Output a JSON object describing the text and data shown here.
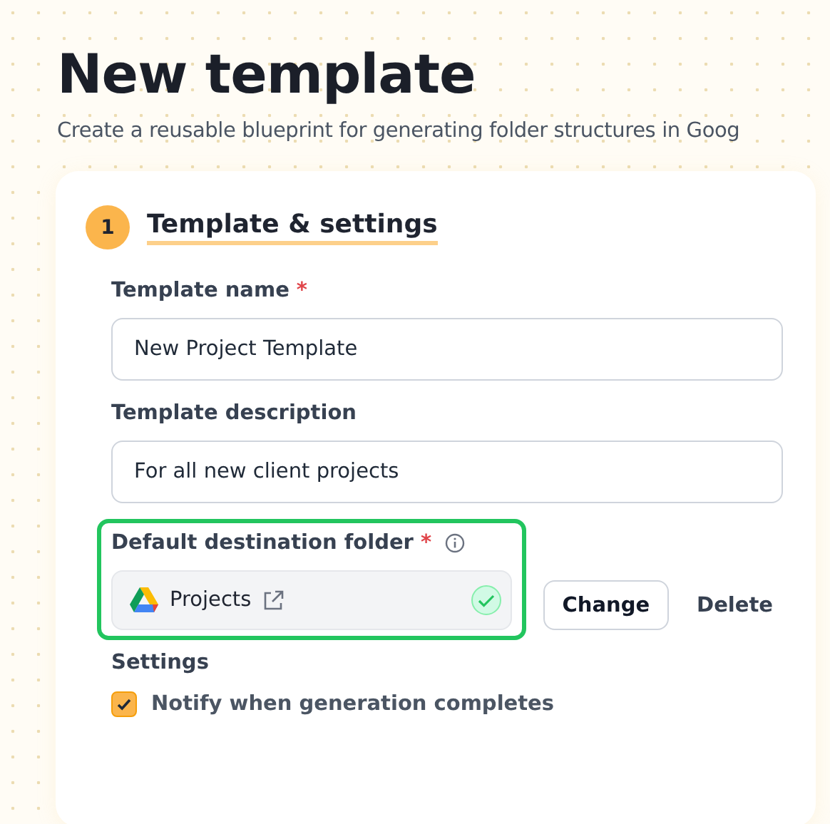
{
  "page": {
    "title": "New template",
    "subtitle": "Create a reusable blueprint for generating folder structures in Goog"
  },
  "section": {
    "step": "1",
    "title": "Template & settings"
  },
  "fields": [
    {
      "label": "Template name",
      "required_mark": "*",
      "value": "New Project Template"
    },
    {
      "label": "Template description",
      "value": "For all new client projects"
    }
  ],
  "destination": {
    "label": "Default destination folder",
    "required_mark": "*",
    "highlighted": true,
    "folder": "Projects",
    "verified": true,
    "buttons": [
      {
        "label": "Change",
        "kind": "outline"
      },
      {
        "label": "Delete",
        "kind": "text"
      }
    ]
  },
  "settings": {
    "label": "Settings",
    "options": [
      {
        "label": "Notify when generation completes",
        "checked": true
      }
    ]
  }
}
